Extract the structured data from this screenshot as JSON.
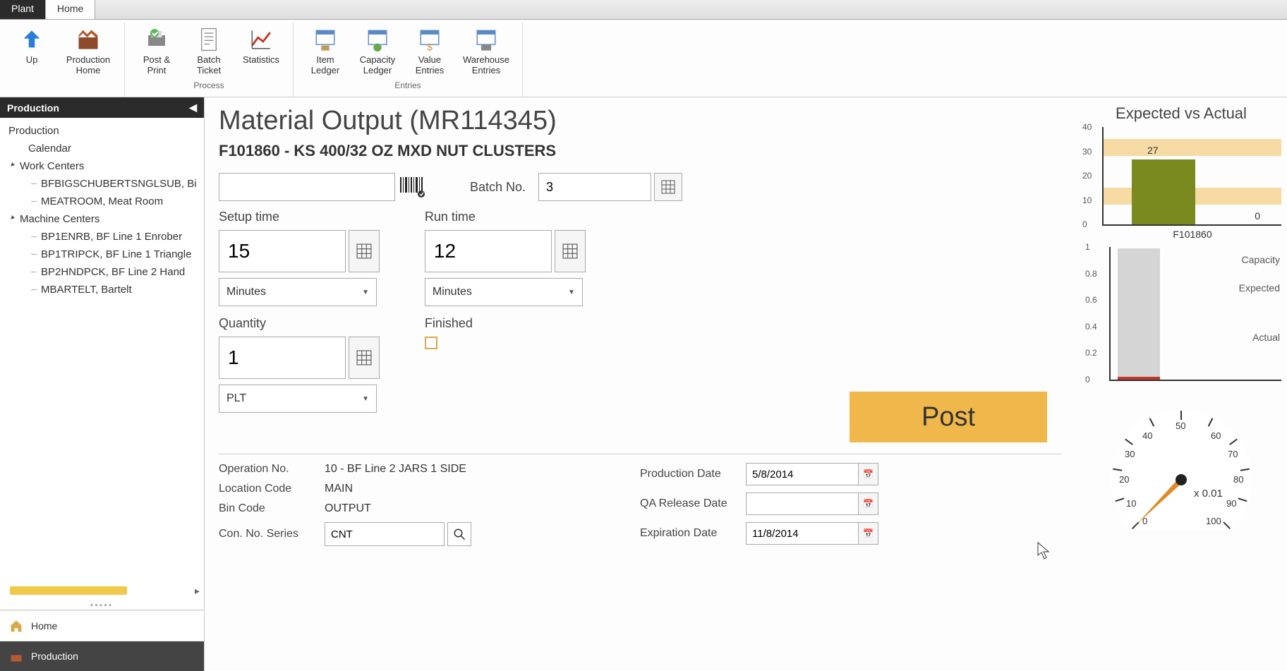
{
  "tabs": {
    "plant": "Plant",
    "home": "Home"
  },
  "ribbon": {
    "nav": {
      "up": "Up",
      "prod_home": "Production\nHome"
    },
    "process": {
      "group_label": "Process",
      "post_print": "Post &\nPrint",
      "batch_ticket": "Batch\nTicket",
      "statistics": "Statistics"
    },
    "entries": {
      "group_label": "Entries",
      "item_ledger": "Item\nLedger",
      "capacity_ledger": "Capacity\nLedger",
      "value_entries": "Value\nEntries",
      "warehouse_entries": "Warehouse\nEntries"
    }
  },
  "sidebar": {
    "header": "Production",
    "root": "Production",
    "calendar": "Calendar",
    "work_centers": "Work Centers",
    "wc1": "BFBIGSCHUBERTSNGLSUB,  Bi",
    "wc2": "MEATROOM,  Meat Room",
    "machine_centers": "Machine Centers",
    "mc1": "BP1ENRB,  BF Line 1 Enrober",
    "mc2": "BP1TRIPCK,  BF Line 1 Triangle",
    "mc3": "BP2HNDPCK,  BF Line 2 Hand",
    "mc4": "MBARTELT,  Bartelt",
    "footer_home": "Home",
    "footer_prod": "Production"
  },
  "page": {
    "title": "Material Output  (MR114345)",
    "item_code": "F101860",
    "item_sep": "   -   ",
    "item_desc": "KS 400/32 OZ MXD NUT CLUSTERS",
    "batch_label": "Batch No.",
    "batch_value": "3",
    "setup_label": "Setup time",
    "setup_value": "15",
    "setup_unit": "Minutes",
    "run_label": "Run time",
    "run_value": "12",
    "run_unit": "Minutes",
    "qty_label": "Quantity",
    "qty_value": "1",
    "qty_unit": "PLT",
    "finished_label": "Finished",
    "post_btn": "Post"
  },
  "details": {
    "op_no_label": "Operation No.",
    "op_no_value": "10 - BF Line 2 JARS 1 SIDE",
    "loc_label": "Location Code",
    "loc_value": "MAIN",
    "bin_label": "Bin Code",
    "bin_value": "OUTPUT",
    "con_label": "Con. No. Series",
    "con_value": "CNT",
    "prod_date_label": "Production Date",
    "prod_date_value": "5/8/2014",
    "qa_date_label": "QA Release Date",
    "qa_date_value": "",
    "exp_date_label": "Expiration Date",
    "exp_date_value": "11/8/2014"
  },
  "charts": {
    "title": "Expected vs Actual",
    "legend": {
      "capacity": "Capacity",
      "expected": "Expected",
      "actual": "Actual"
    },
    "gauge_value": "x 0.01"
  },
  "chart_data": [
    {
      "type": "bar",
      "title": "Expected vs Actual",
      "categories": [
        "F101860"
      ],
      "series": [
        {
          "name": "Actual",
          "values": [
            27
          ]
        },
        {
          "name": "Expected",
          "values": [
            0
          ]
        }
      ],
      "ylim": [
        0,
        40
      ],
      "yticks": [
        0,
        10,
        20,
        30,
        40
      ],
      "data_labels": [
        27,
        0
      ]
    },
    {
      "type": "bar",
      "categories": [
        "Capacity"
      ],
      "series": [
        {
          "name": "Capacity",
          "values": [
            1.0
          ]
        },
        {
          "name": "Expected",
          "values": [
            0.0
          ]
        },
        {
          "name": "Actual",
          "values": [
            0.02
          ]
        }
      ],
      "ylim": [
        0,
        1
      ],
      "yticks": [
        0,
        0.2,
        0.4,
        0.6,
        0.8,
        1
      ]
    },
    {
      "type": "gauge",
      "value": 0,
      "min": 0,
      "max": 100,
      "ticks": [
        0,
        10,
        20,
        30,
        40,
        50,
        60,
        70,
        80,
        90,
        100
      ],
      "unit_label": "x 0.01"
    }
  ]
}
